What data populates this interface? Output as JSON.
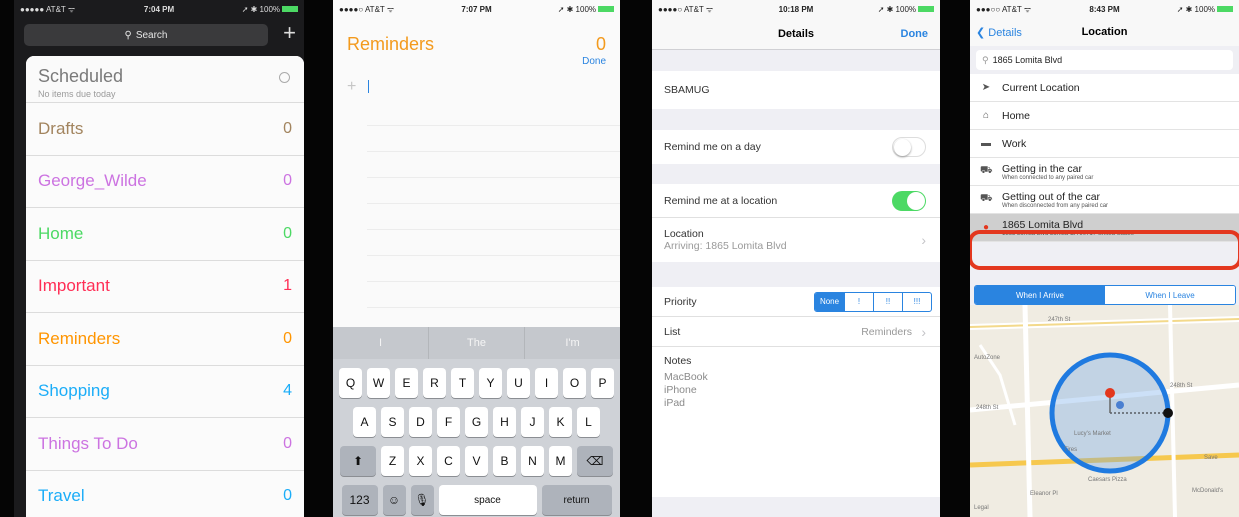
{
  "phone1": {
    "status": {
      "carrier": "●●●●● AT&T ᯤ",
      "time": "7:04 PM",
      "battery": "➚ ✱ 100%"
    },
    "search_placeholder": "Search",
    "add_icon": "plus-icon",
    "scheduled": {
      "title": "Scheduled",
      "subtitle": "No items due today"
    },
    "lists": [
      {
        "name": "Drafts",
        "count": "0",
        "color": "#a2845e"
      },
      {
        "name": "George_Wilde",
        "count": "0",
        "color": "#cc73e1"
      },
      {
        "name": "Home",
        "count": "0",
        "color": "#4cd964"
      },
      {
        "name": "Important",
        "count": "1",
        "color": "#ff2d55"
      },
      {
        "name": "Reminders",
        "count": "0",
        "color": "#ff9500"
      },
      {
        "name": "Shopping",
        "count": "4",
        "color": "#1badf8"
      },
      {
        "name": "Things To Do",
        "count": "0",
        "color": "#cc73e1"
      },
      {
        "name": "Travel",
        "count": "0",
        "color": "#1badf8"
      }
    ]
  },
  "phone2": {
    "status": {
      "carrier": "●●●●○ AT&T ᯤ",
      "time": "7:07 PM",
      "battery": "➚ ✱ 100%"
    },
    "title": "Reminders",
    "count": "0",
    "done": "Done",
    "suggestions": [
      "I",
      "The",
      "I'm"
    ],
    "row1": [
      "Q",
      "W",
      "E",
      "R",
      "T",
      "Y",
      "U",
      "I",
      "O",
      "P"
    ],
    "row2": [
      "A",
      "S",
      "D",
      "F",
      "G",
      "H",
      "J",
      "K",
      "L"
    ],
    "row3": [
      "Z",
      "X",
      "C",
      "V",
      "B",
      "N",
      "M"
    ],
    "num_key": "123",
    "space_key": "space",
    "return_key": "return"
  },
  "phone3": {
    "status": {
      "carrier": "●●●●○ AT&T ᯤ",
      "time": "10:18 PM",
      "battery": "➚ ✱ 100%"
    },
    "title": "Details",
    "done": "Done",
    "item_title": "SBAMUG",
    "remind_day": "Remind me on a day",
    "remind_location": "Remind me at a location",
    "location_label": "Location",
    "location_value": "Arriving: 1865 Lomita Blvd",
    "priority_label": "Priority",
    "priority_options": [
      "None",
      "!",
      "!!",
      "!!!"
    ],
    "list_label": "List",
    "list_value": "Reminders",
    "notes_label": "Notes",
    "notes": [
      "MacBook",
      "iPhone",
      "iPad"
    ]
  },
  "phone4": {
    "status": {
      "carrier": "●●●○○ AT&T ᯤ",
      "time": "8:43 PM",
      "battery": "➚ ✱ 100%"
    },
    "back": "Details",
    "title": "Location",
    "search_value": "1865 Lomita Blvd",
    "rows": [
      {
        "icon": "location-arrow-icon",
        "label": "Current Location",
        "sub": ""
      },
      {
        "icon": "home-icon",
        "label": "Home",
        "sub": ""
      },
      {
        "icon": "work-icon",
        "label": "Work",
        "sub": ""
      },
      {
        "icon": "car-icon",
        "label": "Getting in the car",
        "sub": "When connected to any paired car"
      },
      {
        "icon": "car-icon",
        "label": "Getting out of the car",
        "sub": "When disconnected from any paired car"
      },
      {
        "icon": "pin-icon",
        "label": "1865 Lomita Blvd",
        "sub": "1865 Lomita Blvd Lomita CA 90717 United States"
      }
    ],
    "tabs": [
      "When I Arrive",
      "When I Leave"
    ],
    "map_labels": [
      "247th St",
      "AutoZone",
      "248th St",
      "248th St",
      "Lucy's Market",
      "Tires",
      "Caesars Pizza",
      "McDonald's",
      "Eleanor Pl",
      "Legal",
      "Save"
    ]
  }
}
